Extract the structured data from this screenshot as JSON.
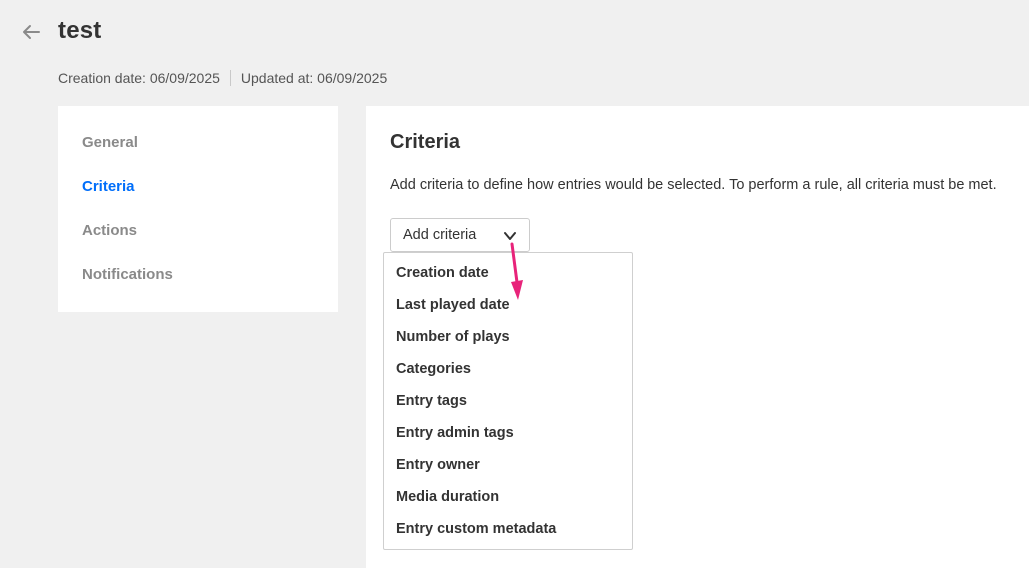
{
  "header": {
    "back_icon": "arrow-left-icon",
    "title": "test",
    "creation_date": "Creation date: 06/09/2025",
    "updated_at": "Updated at: 06/09/2025"
  },
  "sidebar": {
    "items": [
      {
        "label": "General",
        "active": false
      },
      {
        "label": "Criteria",
        "active": true
      },
      {
        "label": "Actions",
        "active": false
      },
      {
        "label": "Notifications",
        "active": false
      }
    ]
  },
  "main": {
    "section_title": "Criteria",
    "description": "Add criteria to define how entries would be selected. To perform a rule, all criteria must be met.",
    "add_criteria": {
      "label": "Add criteria",
      "icon": "chevron-down-icon"
    }
  },
  "dropdown": {
    "options": [
      "Creation date",
      "Last played date",
      "Number of plays",
      "Categories",
      "Entry tags",
      "Entry admin tags",
      "Entry owner",
      "Media duration",
      "Entry custom metadata"
    ]
  },
  "colors": {
    "accent": "#006efa",
    "annotation_arrow": "#e8237a",
    "background": "#f0f0f0"
  }
}
